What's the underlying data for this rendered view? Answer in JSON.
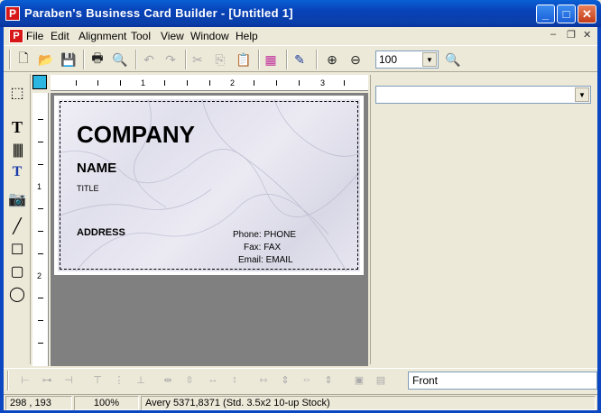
{
  "window": {
    "title": "Paraben's Business Card Builder  - [Untitled 1]",
    "app_letter": "P",
    "minimize": "_",
    "maximize": "□",
    "close": "✕"
  },
  "menu": {
    "items": [
      "File",
      "Edit",
      "Alignment",
      "Tool",
      "View",
      "Window",
      "Help"
    ],
    "mdi_minimize": "–",
    "mdi_restore": "❐",
    "mdi_close": "✕"
  },
  "toolbar": {
    "zoom_value": "100"
  },
  "ruler": {
    "h_numbers": [
      "1",
      "2",
      "3"
    ],
    "v_numbers": [
      "1",
      "2"
    ]
  },
  "card": {
    "company": "COMPANY",
    "name": "NAME",
    "title": "TITLE",
    "address": "ADDRESS",
    "phone_label": "Phone:",
    "phone_value": "PHONE",
    "fax_label": "Fax:",
    "fax_value": "FAX",
    "email_label": "Email:",
    "email_value": "EMAIL"
  },
  "bottom": {
    "side_value": "Front"
  },
  "status": {
    "coords": "298 , 193",
    "zoom": "100%",
    "stock": "Avery 5371,8371 (Std. 3.5x2 10-up Stock)"
  },
  "colors": {
    "titlebar": "#0a47c0",
    "chrome": "#ece9d8",
    "canvas": "#808080",
    "ruler_corner": "#2ab6e0"
  }
}
